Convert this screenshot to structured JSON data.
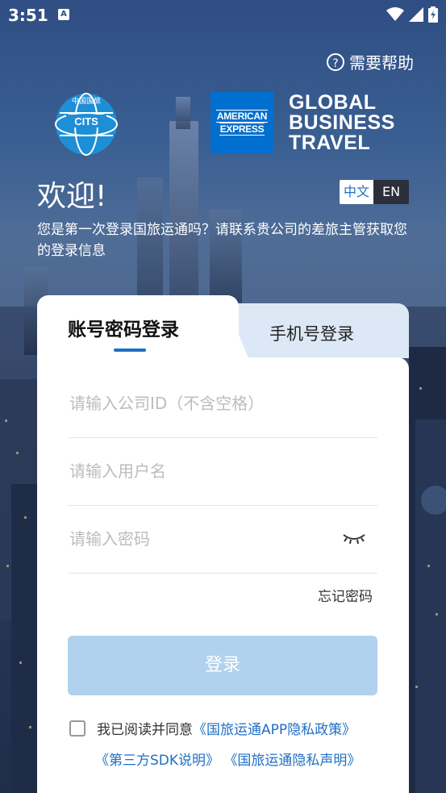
{
  "status": {
    "time": "3:51",
    "notification_icon": "A"
  },
  "help": {
    "label": "需要帮助"
  },
  "brand": {
    "cits_text": "CITS",
    "cits_top_text": "中国国旅",
    "amex_line1": "AMERICAN",
    "amex_line2": "EXPRESS",
    "gbt_line1": "GLOBAL",
    "gbt_line2": "BUSINESS",
    "gbt_line3": "TRAVEL",
    "amex_color": "#006fcf"
  },
  "welcome": {
    "title": "欢迎!",
    "intro": "您是第一次登录国旅运通吗？请联系贵公司的差旅主管获取您的登录信息"
  },
  "language": {
    "zh": "中文",
    "en": "EN",
    "selected": "中文"
  },
  "tabs": {
    "account_login": "账号密码登录",
    "phone_login": "手机号登录",
    "active": "账号密码登录"
  },
  "form": {
    "company_id_placeholder": "请输入公司ID（不含空格）",
    "username_placeholder": "请输入用户名",
    "password_placeholder": "请输入密码",
    "forgot_password": "忘记密码",
    "login_button": "登录"
  },
  "agreement": {
    "prefix": "我已阅读并同意",
    "privacy_policy": "《国旅运通APP隐私政策》",
    "sdk_note": "《第三方SDK说明》",
    "privacy_statement": "《国旅运通隐私声明》"
  },
  "colors": {
    "accent": "#1f6fc5",
    "button_disabled": "#b0d2ee",
    "inactive_tab": "#dce8f6"
  }
}
